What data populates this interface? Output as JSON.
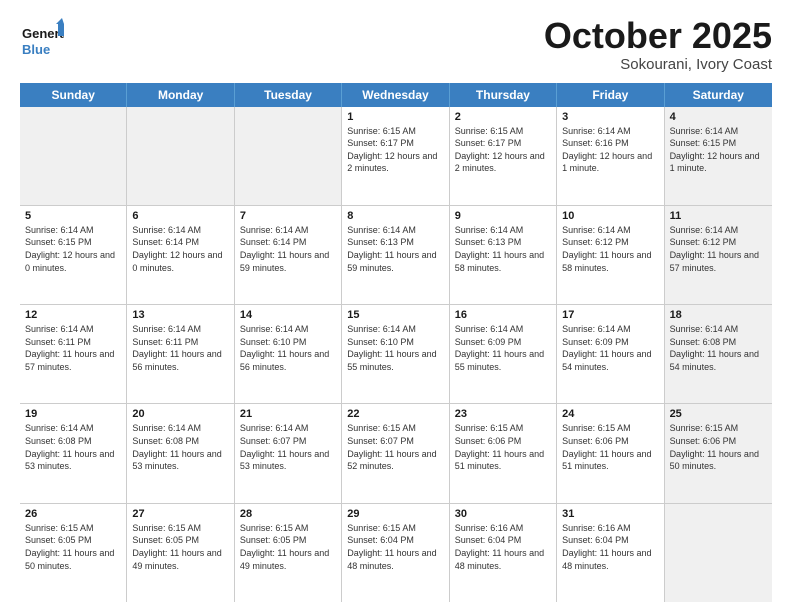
{
  "header": {
    "logo_general": "General",
    "logo_blue": "Blue",
    "month_title": "October 2025",
    "location": "Sokourani, Ivory Coast"
  },
  "days_of_week": [
    "Sunday",
    "Monday",
    "Tuesday",
    "Wednesday",
    "Thursday",
    "Friday",
    "Saturday"
  ],
  "weeks": [
    [
      {
        "day": "",
        "info": "",
        "shaded": true
      },
      {
        "day": "",
        "info": "",
        "shaded": true
      },
      {
        "day": "",
        "info": "",
        "shaded": true
      },
      {
        "day": "1",
        "info": "Sunrise: 6:15 AM\nSunset: 6:17 PM\nDaylight: 12 hours and 2 minutes.",
        "shaded": false
      },
      {
        "day": "2",
        "info": "Sunrise: 6:15 AM\nSunset: 6:17 PM\nDaylight: 12 hours and 2 minutes.",
        "shaded": false
      },
      {
        "day": "3",
        "info": "Sunrise: 6:14 AM\nSunset: 6:16 PM\nDaylight: 12 hours and 1 minute.",
        "shaded": false
      },
      {
        "day": "4",
        "info": "Sunrise: 6:14 AM\nSunset: 6:15 PM\nDaylight: 12 hours and 1 minute.",
        "shaded": true
      }
    ],
    [
      {
        "day": "5",
        "info": "Sunrise: 6:14 AM\nSunset: 6:15 PM\nDaylight: 12 hours and 0 minutes.",
        "shaded": false
      },
      {
        "day": "6",
        "info": "Sunrise: 6:14 AM\nSunset: 6:14 PM\nDaylight: 12 hours and 0 minutes.",
        "shaded": false
      },
      {
        "day": "7",
        "info": "Sunrise: 6:14 AM\nSunset: 6:14 PM\nDaylight: 11 hours and 59 minutes.",
        "shaded": false
      },
      {
        "day": "8",
        "info": "Sunrise: 6:14 AM\nSunset: 6:13 PM\nDaylight: 11 hours and 59 minutes.",
        "shaded": false
      },
      {
        "day": "9",
        "info": "Sunrise: 6:14 AM\nSunset: 6:13 PM\nDaylight: 11 hours and 58 minutes.",
        "shaded": false
      },
      {
        "day": "10",
        "info": "Sunrise: 6:14 AM\nSunset: 6:12 PM\nDaylight: 11 hours and 58 minutes.",
        "shaded": false
      },
      {
        "day": "11",
        "info": "Sunrise: 6:14 AM\nSunset: 6:12 PM\nDaylight: 11 hours and 57 minutes.",
        "shaded": true
      }
    ],
    [
      {
        "day": "12",
        "info": "Sunrise: 6:14 AM\nSunset: 6:11 PM\nDaylight: 11 hours and 57 minutes.",
        "shaded": false
      },
      {
        "day": "13",
        "info": "Sunrise: 6:14 AM\nSunset: 6:11 PM\nDaylight: 11 hours and 56 minutes.",
        "shaded": false
      },
      {
        "day": "14",
        "info": "Sunrise: 6:14 AM\nSunset: 6:10 PM\nDaylight: 11 hours and 56 minutes.",
        "shaded": false
      },
      {
        "day": "15",
        "info": "Sunrise: 6:14 AM\nSunset: 6:10 PM\nDaylight: 11 hours and 55 minutes.",
        "shaded": false
      },
      {
        "day": "16",
        "info": "Sunrise: 6:14 AM\nSunset: 6:09 PM\nDaylight: 11 hours and 55 minutes.",
        "shaded": false
      },
      {
        "day": "17",
        "info": "Sunrise: 6:14 AM\nSunset: 6:09 PM\nDaylight: 11 hours and 54 minutes.",
        "shaded": false
      },
      {
        "day": "18",
        "info": "Sunrise: 6:14 AM\nSunset: 6:08 PM\nDaylight: 11 hours and 54 minutes.",
        "shaded": true
      }
    ],
    [
      {
        "day": "19",
        "info": "Sunrise: 6:14 AM\nSunset: 6:08 PM\nDaylight: 11 hours and 53 minutes.",
        "shaded": false
      },
      {
        "day": "20",
        "info": "Sunrise: 6:14 AM\nSunset: 6:08 PM\nDaylight: 11 hours and 53 minutes.",
        "shaded": false
      },
      {
        "day": "21",
        "info": "Sunrise: 6:14 AM\nSunset: 6:07 PM\nDaylight: 11 hours and 53 minutes.",
        "shaded": false
      },
      {
        "day": "22",
        "info": "Sunrise: 6:15 AM\nSunset: 6:07 PM\nDaylight: 11 hours and 52 minutes.",
        "shaded": false
      },
      {
        "day": "23",
        "info": "Sunrise: 6:15 AM\nSunset: 6:06 PM\nDaylight: 11 hours and 51 minutes.",
        "shaded": false
      },
      {
        "day": "24",
        "info": "Sunrise: 6:15 AM\nSunset: 6:06 PM\nDaylight: 11 hours and 51 minutes.",
        "shaded": false
      },
      {
        "day": "25",
        "info": "Sunrise: 6:15 AM\nSunset: 6:06 PM\nDaylight: 11 hours and 50 minutes.",
        "shaded": true
      }
    ],
    [
      {
        "day": "26",
        "info": "Sunrise: 6:15 AM\nSunset: 6:05 PM\nDaylight: 11 hours and 50 minutes.",
        "shaded": false
      },
      {
        "day": "27",
        "info": "Sunrise: 6:15 AM\nSunset: 6:05 PM\nDaylight: 11 hours and 49 minutes.",
        "shaded": false
      },
      {
        "day": "28",
        "info": "Sunrise: 6:15 AM\nSunset: 6:05 PM\nDaylight: 11 hours and 49 minutes.",
        "shaded": false
      },
      {
        "day": "29",
        "info": "Sunrise: 6:15 AM\nSunset: 6:04 PM\nDaylight: 11 hours and 48 minutes.",
        "shaded": false
      },
      {
        "day": "30",
        "info": "Sunrise: 6:16 AM\nSunset: 6:04 PM\nDaylight: 11 hours and 48 minutes.",
        "shaded": false
      },
      {
        "day": "31",
        "info": "Sunrise: 6:16 AM\nSunset: 6:04 PM\nDaylight: 11 hours and 48 minutes.",
        "shaded": false
      },
      {
        "day": "",
        "info": "",
        "shaded": true
      }
    ]
  ]
}
